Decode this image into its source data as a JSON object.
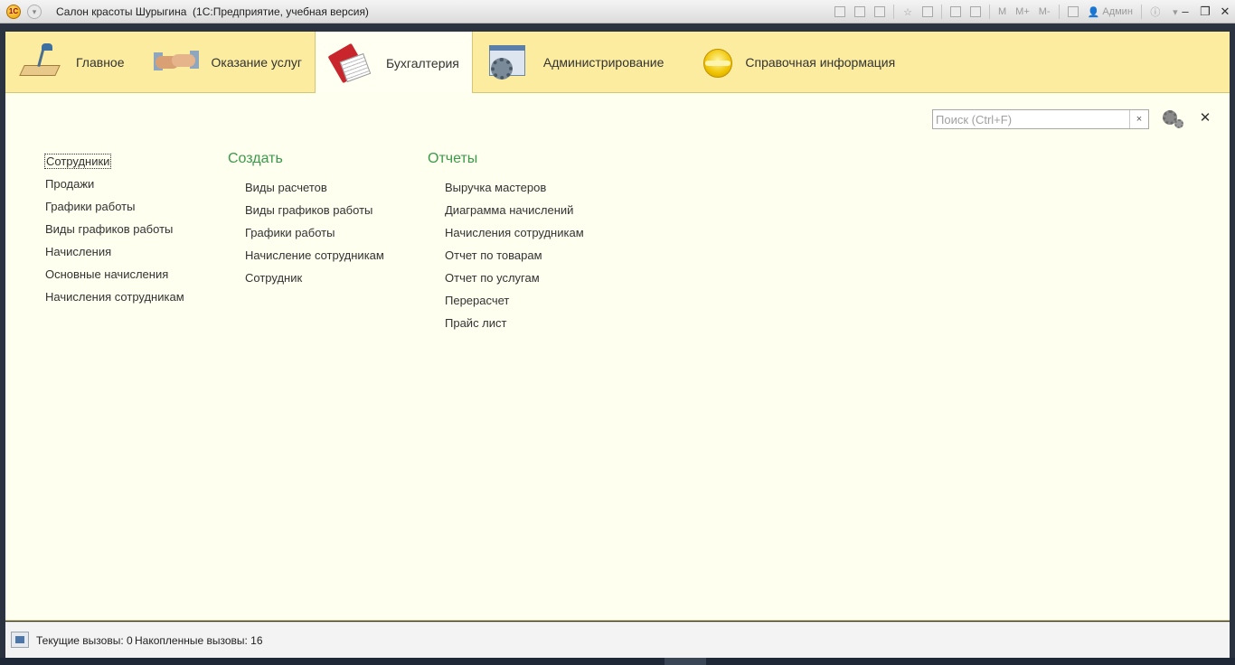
{
  "window": {
    "title": "Салон красоты Шурыгина  (1С:Предприятие, учебная версия)",
    "user": "Админ",
    "memory_buttons": [
      "M",
      "M+",
      "M-"
    ],
    "controls": [
      "–",
      "❐",
      "✕"
    ]
  },
  "sections": [
    {
      "label": "Главное",
      "icon": "desk-lamp-icon",
      "active": false
    },
    {
      "label": "Оказание услуг",
      "icon": "handshake-icon",
      "active": false
    },
    {
      "label": "Бухгалтерия",
      "icon": "ledger-book-icon",
      "active": true
    },
    {
      "label": "Администрирование",
      "icon": "admin-window-gear-icon",
      "active": false
    },
    {
      "label": "Справочная информация",
      "icon": "info-disc-icon",
      "active": false
    }
  ],
  "search": {
    "placeholder": "Поиск (Ctrl+F)",
    "value": "",
    "clear": "×"
  },
  "close_label": "✕",
  "nav": {
    "items": [
      "Сотрудники",
      "Продажи",
      "Графики работы",
      "Виды графиков работы",
      "Начисления",
      "Основные начисления",
      "Начисления сотрудникам"
    ]
  },
  "create": {
    "header": "Создать",
    "items": [
      "Виды расчетов",
      "Виды графиков работы",
      "Графики работы",
      "Начисление сотрудникам",
      "Сотрудник"
    ]
  },
  "reports": {
    "header": "Отчеты",
    "items": [
      "Выручка мастеров",
      "Диаграмма начислений",
      "Начисления сотрудникам",
      "Отчет по товарам",
      "Отчет по услугам",
      "Перерасчет",
      "Прайс лист"
    ]
  },
  "status": {
    "current_calls": "Текущие вызовы: 0",
    "accumulated_calls": "Накопленные вызовы: 16"
  },
  "colors": {
    "section_bg": "#fbec9f",
    "content_bg": "#fffff0",
    "header_green": "#3a9a4a"
  }
}
